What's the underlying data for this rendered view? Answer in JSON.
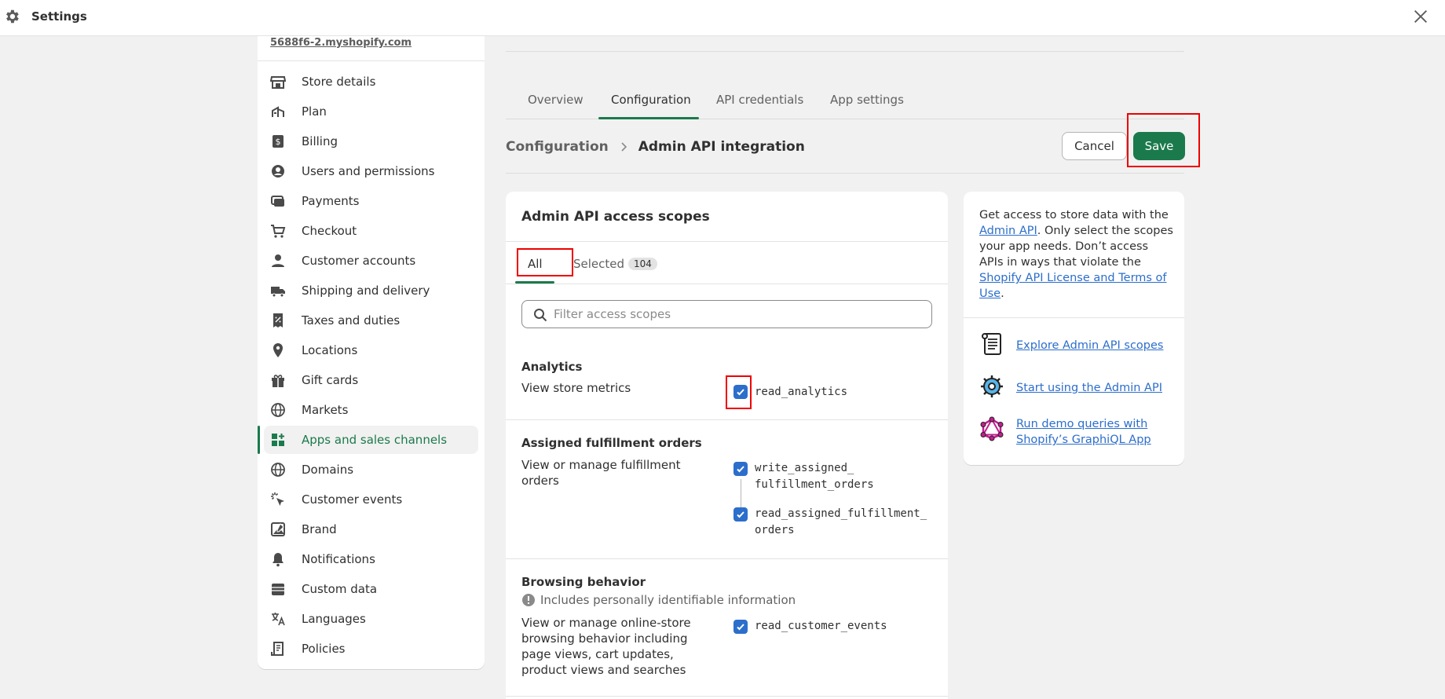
{
  "topbar": {
    "title": "Settings",
    "icons": [
      "gear-icon",
      "close-icon"
    ]
  },
  "sidebar": {
    "store_url": "5688f6-2.myshopify.com",
    "items": [
      {
        "label": "Store details",
        "icon": "store-icon"
      },
      {
        "label": "Plan",
        "icon": "plan-icon"
      },
      {
        "label": "Billing",
        "icon": "billing-icon"
      },
      {
        "label": "Users and permissions",
        "icon": "user-circle-icon"
      },
      {
        "label": "Payments",
        "icon": "payments-icon"
      },
      {
        "label": "Checkout",
        "icon": "cart-icon"
      },
      {
        "label": "Customer accounts",
        "icon": "person-icon"
      },
      {
        "label": "Shipping and delivery",
        "icon": "truck-icon"
      },
      {
        "label": "Taxes and duties",
        "icon": "receipt-icon"
      },
      {
        "label": "Locations",
        "icon": "location-icon"
      },
      {
        "label": "Gift cards",
        "icon": "gift-icon"
      },
      {
        "label": "Markets",
        "icon": "globe-icon"
      },
      {
        "label": "Apps and sales channels",
        "icon": "apps-icon",
        "active": true
      },
      {
        "label": "Domains",
        "icon": "globe-icon"
      },
      {
        "label": "Customer events",
        "icon": "cursor-icon"
      },
      {
        "label": "Brand",
        "icon": "brand-icon"
      },
      {
        "label": "Notifications",
        "icon": "bell-icon"
      },
      {
        "label": "Custom data",
        "icon": "database-icon"
      },
      {
        "label": "Languages",
        "icon": "language-icon"
      },
      {
        "label": "Policies",
        "icon": "policy-icon"
      }
    ]
  },
  "tabs": [
    {
      "label": "Overview"
    },
    {
      "label": "Configuration",
      "active": true
    },
    {
      "label": "API credentials"
    },
    {
      "label": "App settings"
    }
  ],
  "breadcrumb": {
    "parent": "Configuration",
    "current": "Admin API integration"
  },
  "actions": {
    "cancel": "Cancel",
    "save": "Save"
  },
  "scopes_card": {
    "title": "Admin API access scopes",
    "tab_all": "All",
    "tab_selected": "Selected",
    "selected_count": "104",
    "filter_placeholder": "Filter access scopes",
    "sections": [
      {
        "title": "Analytics",
        "description": "View store metrics",
        "scopes": [
          {
            "name": "read_analytics",
            "checked": true
          }
        ]
      },
      {
        "title": "Assigned fulfillment orders",
        "description": "View or manage fulfillment orders",
        "scopes": [
          {
            "name_line1": "write_assigned_",
            "name_line2": "fulfillment_orders",
            "checked": true
          },
          {
            "name_line1": "read_assigned_fulfillment_",
            "name_line2": "orders",
            "checked": true
          }
        ]
      },
      {
        "title": "Browsing behavior",
        "pii_note": "Includes personally identifiable information",
        "description": "View or manage online-store browsing behavior including page views, cart updates, product views and searches",
        "scopes": [
          {
            "name": "read_customer_events",
            "checked": true
          }
        ]
      }
    ]
  },
  "info_card": {
    "text_1": "Get access to store data with the ",
    "link_admin_api": "Admin API",
    "text_2": ". Only select the scopes your app needs. Don’t access APIs in ways that violate the ",
    "link_license": "Shopify API License and Terms of Use",
    "text_3": ".",
    "links": [
      {
        "label": "Explore Admin API scopes",
        "icon": "scroll-icon"
      },
      {
        "label": "Start using the Admin API",
        "icon": "gear-sparkle-icon"
      },
      {
        "label": "Run demo queries with Shopify’s GraphiQL App",
        "icon": "graphql-icon"
      }
    ]
  },
  "colors": {
    "brand": "#1b7a4c",
    "link": "#2c6ecb",
    "highlight": "#ee0000"
  }
}
